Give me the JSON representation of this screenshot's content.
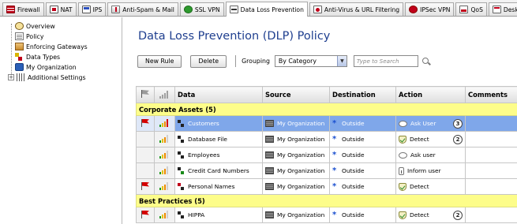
{
  "tabs": [
    {
      "label": "Firewall",
      "icon": "firewall-icon",
      "active": false
    },
    {
      "label": "NAT",
      "icon": "nat-icon",
      "active": false
    },
    {
      "label": "IPS",
      "icon": "ips-icon",
      "active": false
    },
    {
      "label": "Anti-Spam & Mail",
      "icon": "anti-spam-icon",
      "active": false
    },
    {
      "label": "SSL VPN",
      "icon": "ssl-vpn-icon",
      "active": false
    },
    {
      "label": "Data Loss Prevention",
      "icon": "dlp-icon",
      "active": true
    },
    {
      "label": "Anti-Virus & URL Filtering",
      "icon": "anti-virus-icon",
      "active": false
    },
    {
      "label": "IPSec VPN",
      "icon": "ipsec-vpn-icon",
      "active": false
    },
    {
      "label": "QoS",
      "icon": "qos-icon",
      "active": false
    },
    {
      "label": "Desktop",
      "icon": "desktop-icon",
      "active": false
    }
  ],
  "sidebar": {
    "items": [
      {
        "label": "Overview",
        "icon": "overview-icon"
      },
      {
        "label": "Policy",
        "icon": "policy-icon"
      },
      {
        "label": "Enforcing Gateways",
        "icon": "gateway-icon"
      },
      {
        "label": "Data Types",
        "icon": "data-types-icon"
      },
      {
        "label": "My Organization",
        "icon": "organization-icon"
      },
      {
        "label": "Additional Settings",
        "icon": "settings-icon",
        "expander": "+"
      }
    ]
  },
  "main": {
    "title": "Data Loss Prevention (DLP) Policy",
    "toolbar": {
      "new_rule_label": "New Rule",
      "delete_label": "Delete",
      "grouping_label": "Grouping",
      "grouping_value": "By Category",
      "search_placeholder": "Type to Search"
    },
    "columns": [
      "Data",
      "Source",
      "Destination",
      "Action",
      "Comments"
    ],
    "groups": [
      {
        "label": "Corporate Assets (5)",
        "rows": [
          {
            "flag": true,
            "severity": "high",
            "data": "Customers",
            "data_icon": "data-type-icon",
            "source": "My Organization",
            "destination": "Outside",
            "action": "Ask User",
            "action_icon": "ask-user-icon",
            "count": "3",
            "selected": true
          },
          {
            "flag": false,
            "severity": "medium",
            "data": "Database File",
            "data_icon": "data-type-icon",
            "source": "My Organization",
            "destination": "Outside",
            "action": "Detect",
            "action_icon": "detect-icon",
            "count": "2",
            "selected": false
          },
          {
            "flag": false,
            "severity": "medium",
            "data": "Employees",
            "data_icon": "data-type-icon",
            "source": "My Organization",
            "destination": "Outside",
            "action": "Ask user",
            "action_icon": "ask-user-icon",
            "count": "",
            "selected": false
          },
          {
            "flag": false,
            "severity": "medium",
            "data": "Credit Card Numbers",
            "data_icon": "data-type-icon",
            "source": "My Organization",
            "destination": "Outside",
            "action": "Inform user",
            "action_icon": "inform-user-icon",
            "count": "",
            "selected": false
          },
          {
            "flag": true,
            "severity": "medium",
            "data": "Personal Names",
            "data_icon": "data-type-icon",
            "source": "My Organization",
            "destination": "Outside",
            "action": "Detect",
            "action_icon": "detect-icon",
            "count": "",
            "selected": false
          }
        ]
      },
      {
        "label": "Best Practices (5)",
        "rows": [
          {
            "flag": true,
            "severity": "medium",
            "data": "HIPPA",
            "data_icon": "data-type-icon",
            "source": "My Organization",
            "destination": "Outside",
            "action": "Detect",
            "action_icon": "detect-icon",
            "count": "2",
            "selected": false
          }
        ]
      }
    ]
  }
}
